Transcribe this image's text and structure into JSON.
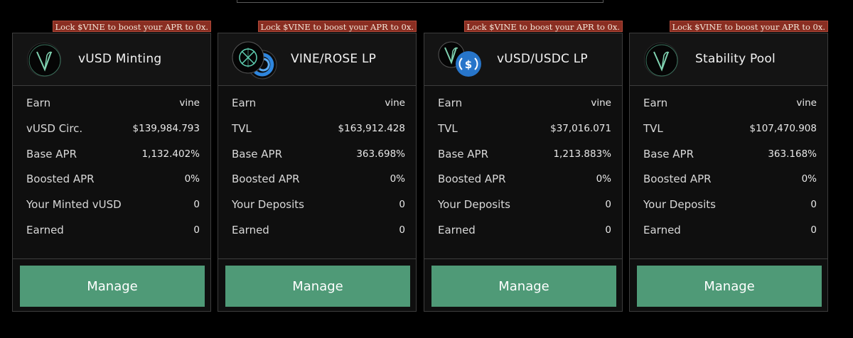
{
  "lock_text": "Lock $VINE to boost your APR to 0x.",
  "accent_color": "#4f9a77",
  "badge_color": "#8a2e22",
  "cards": [
    {
      "title": "vUSD Minting",
      "logo": "vine-logo",
      "rows": [
        {
          "label": "Earn",
          "value": "vine"
        },
        {
          "label": "vUSD Circ.",
          "value": "$139,984.793"
        },
        {
          "label": "Base APR",
          "value": "1,132.402%"
        },
        {
          "label": "Boosted APR",
          "value": "0%"
        },
        {
          "label": "Your Minted vUSD",
          "value": "0"
        },
        {
          "label": "Earned",
          "value": "0"
        }
      ],
      "button": "Manage"
    },
    {
      "title": "VINE/ROSE LP",
      "logo": "rose-logo",
      "rows": [
        {
          "label": "Earn",
          "value": "vine"
        },
        {
          "label": "TVL",
          "value": "$163,912.428"
        },
        {
          "label": "Base APR",
          "value": "363.698%"
        },
        {
          "label": "Boosted APR",
          "value": "0%"
        },
        {
          "label": "Your Deposits",
          "value": "0"
        },
        {
          "label": "Earned",
          "value": "0"
        }
      ],
      "button": "Manage"
    },
    {
      "title": "vUSD/USDC LP",
      "logo": "usdc-logo",
      "rows": [
        {
          "label": "Earn",
          "value": "vine"
        },
        {
          "label": "TVL",
          "value": "$37,016.071"
        },
        {
          "label": "Base APR",
          "value": "1,213.883%"
        },
        {
          "label": "Boosted APR",
          "value": "0%"
        },
        {
          "label": "Your Deposits",
          "value": "0"
        },
        {
          "label": "Earned",
          "value": "0"
        }
      ],
      "button": "Manage"
    },
    {
      "title": "Stability Pool",
      "logo": "vine-logo",
      "rows": [
        {
          "label": "Earn",
          "value": "vine"
        },
        {
          "label": "TVL",
          "value": "$107,470.908"
        },
        {
          "label": "Base APR",
          "value": "363.168%"
        },
        {
          "label": "Boosted APR",
          "value": "0%"
        },
        {
          "label": "Your Deposits",
          "value": "0"
        },
        {
          "label": "Earned",
          "value": "0"
        }
      ],
      "button": "Manage"
    }
  ]
}
